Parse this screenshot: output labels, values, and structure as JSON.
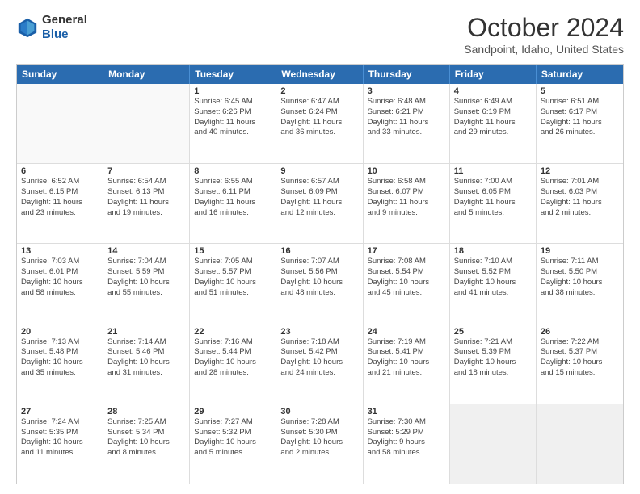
{
  "header": {
    "logo_general": "General",
    "logo_blue": "Blue",
    "month_title": "October 2024",
    "subtitle": "Sandpoint, Idaho, United States"
  },
  "weekdays": [
    "Sunday",
    "Monday",
    "Tuesday",
    "Wednesday",
    "Thursday",
    "Friday",
    "Saturday"
  ],
  "rows": [
    [
      {
        "day": "",
        "info": ""
      },
      {
        "day": "",
        "info": ""
      },
      {
        "day": "1",
        "info": "Sunrise: 6:45 AM\nSunset: 6:26 PM\nDaylight: 11 hours\nand 40 minutes."
      },
      {
        "day": "2",
        "info": "Sunrise: 6:47 AM\nSunset: 6:24 PM\nDaylight: 11 hours\nand 36 minutes."
      },
      {
        "day": "3",
        "info": "Sunrise: 6:48 AM\nSunset: 6:21 PM\nDaylight: 11 hours\nand 33 minutes."
      },
      {
        "day": "4",
        "info": "Sunrise: 6:49 AM\nSunset: 6:19 PM\nDaylight: 11 hours\nand 29 minutes."
      },
      {
        "day": "5",
        "info": "Sunrise: 6:51 AM\nSunset: 6:17 PM\nDaylight: 11 hours\nand 26 minutes."
      }
    ],
    [
      {
        "day": "6",
        "info": "Sunrise: 6:52 AM\nSunset: 6:15 PM\nDaylight: 11 hours\nand 23 minutes."
      },
      {
        "day": "7",
        "info": "Sunrise: 6:54 AM\nSunset: 6:13 PM\nDaylight: 11 hours\nand 19 minutes."
      },
      {
        "day": "8",
        "info": "Sunrise: 6:55 AM\nSunset: 6:11 PM\nDaylight: 11 hours\nand 16 minutes."
      },
      {
        "day": "9",
        "info": "Sunrise: 6:57 AM\nSunset: 6:09 PM\nDaylight: 11 hours\nand 12 minutes."
      },
      {
        "day": "10",
        "info": "Sunrise: 6:58 AM\nSunset: 6:07 PM\nDaylight: 11 hours\nand 9 minutes."
      },
      {
        "day": "11",
        "info": "Sunrise: 7:00 AM\nSunset: 6:05 PM\nDaylight: 11 hours\nand 5 minutes."
      },
      {
        "day": "12",
        "info": "Sunrise: 7:01 AM\nSunset: 6:03 PM\nDaylight: 11 hours\nand 2 minutes."
      }
    ],
    [
      {
        "day": "13",
        "info": "Sunrise: 7:03 AM\nSunset: 6:01 PM\nDaylight: 10 hours\nand 58 minutes."
      },
      {
        "day": "14",
        "info": "Sunrise: 7:04 AM\nSunset: 5:59 PM\nDaylight: 10 hours\nand 55 minutes."
      },
      {
        "day": "15",
        "info": "Sunrise: 7:05 AM\nSunset: 5:57 PM\nDaylight: 10 hours\nand 51 minutes."
      },
      {
        "day": "16",
        "info": "Sunrise: 7:07 AM\nSunset: 5:56 PM\nDaylight: 10 hours\nand 48 minutes."
      },
      {
        "day": "17",
        "info": "Sunrise: 7:08 AM\nSunset: 5:54 PM\nDaylight: 10 hours\nand 45 minutes."
      },
      {
        "day": "18",
        "info": "Sunrise: 7:10 AM\nSunset: 5:52 PM\nDaylight: 10 hours\nand 41 minutes."
      },
      {
        "day": "19",
        "info": "Sunrise: 7:11 AM\nSunset: 5:50 PM\nDaylight: 10 hours\nand 38 minutes."
      }
    ],
    [
      {
        "day": "20",
        "info": "Sunrise: 7:13 AM\nSunset: 5:48 PM\nDaylight: 10 hours\nand 35 minutes."
      },
      {
        "day": "21",
        "info": "Sunrise: 7:14 AM\nSunset: 5:46 PM\nDaylight: 10 hours\nand 31 minutes."
      },
      {
        "day": "22",
        "info": "Sunrise: 7:16 AM\nSunset: 5:44 PM\nDaylight: 10 hours\nand 28 minutes."
      },
      {
        "day": "23",
        "info": "Sunrise: 7:18 AM\nSunset: 5:42 PM\nDaylight: 10 hours\nand 24 minutes."
      },
      {
        "day": "24",
        "info": "Sunrise: 7:19 AM\nSunset: 5:41 PM\nDaylight: 10 hours\nand 21 minutes."
      },
      {
        "day": "25",
        "info": "Sunrise: 7:21 AM\nSunset: 5:39 PM\nDaylight: 10 hours\nand 18 minutes."
      },
      {
        "day": "26",
        "info": "Sunrise: 7:22 AM\nSunset: 5:37 PM\nDaylight: 10 hours\nand 15 minutes."
      }
    ],
    [
      {
        "day": "27",
        "info": "Sunrise: 7:24 AM\nSunset: 5:35 PM\nDaylight: 10 hours\nand 11 minutes."
      },
      {
        "day": "28",
        "info": "Sunrise: 7:25 AM\nSunset: 5:34 PM\nDaylight: 10 hours\nand 8 minutes."
      },
      {
        "day": "29",
        "info": "Sunrise: 7:27 AM\nSunset: 5:32 PM\nDaylight: 10 hours\nand 5 minutes."
      },
      {
        "day": "30",
        "info": "Sunrise: 7:28 AM\nSunset: 5:30 PM\nDaylight: 10 hours\nand 2 minutes."
      },
      {
        "day": "31",
        "info": "Sunrise: 7:30 AM\nSunset: 5:29 PM\nDaylight: 9 hours\nand 58 minutes."
      },
      {
        "day": "",
        "info": ""
      },
      {
        "day": "",
        "info": ""
      }
    ]
  ]
}
